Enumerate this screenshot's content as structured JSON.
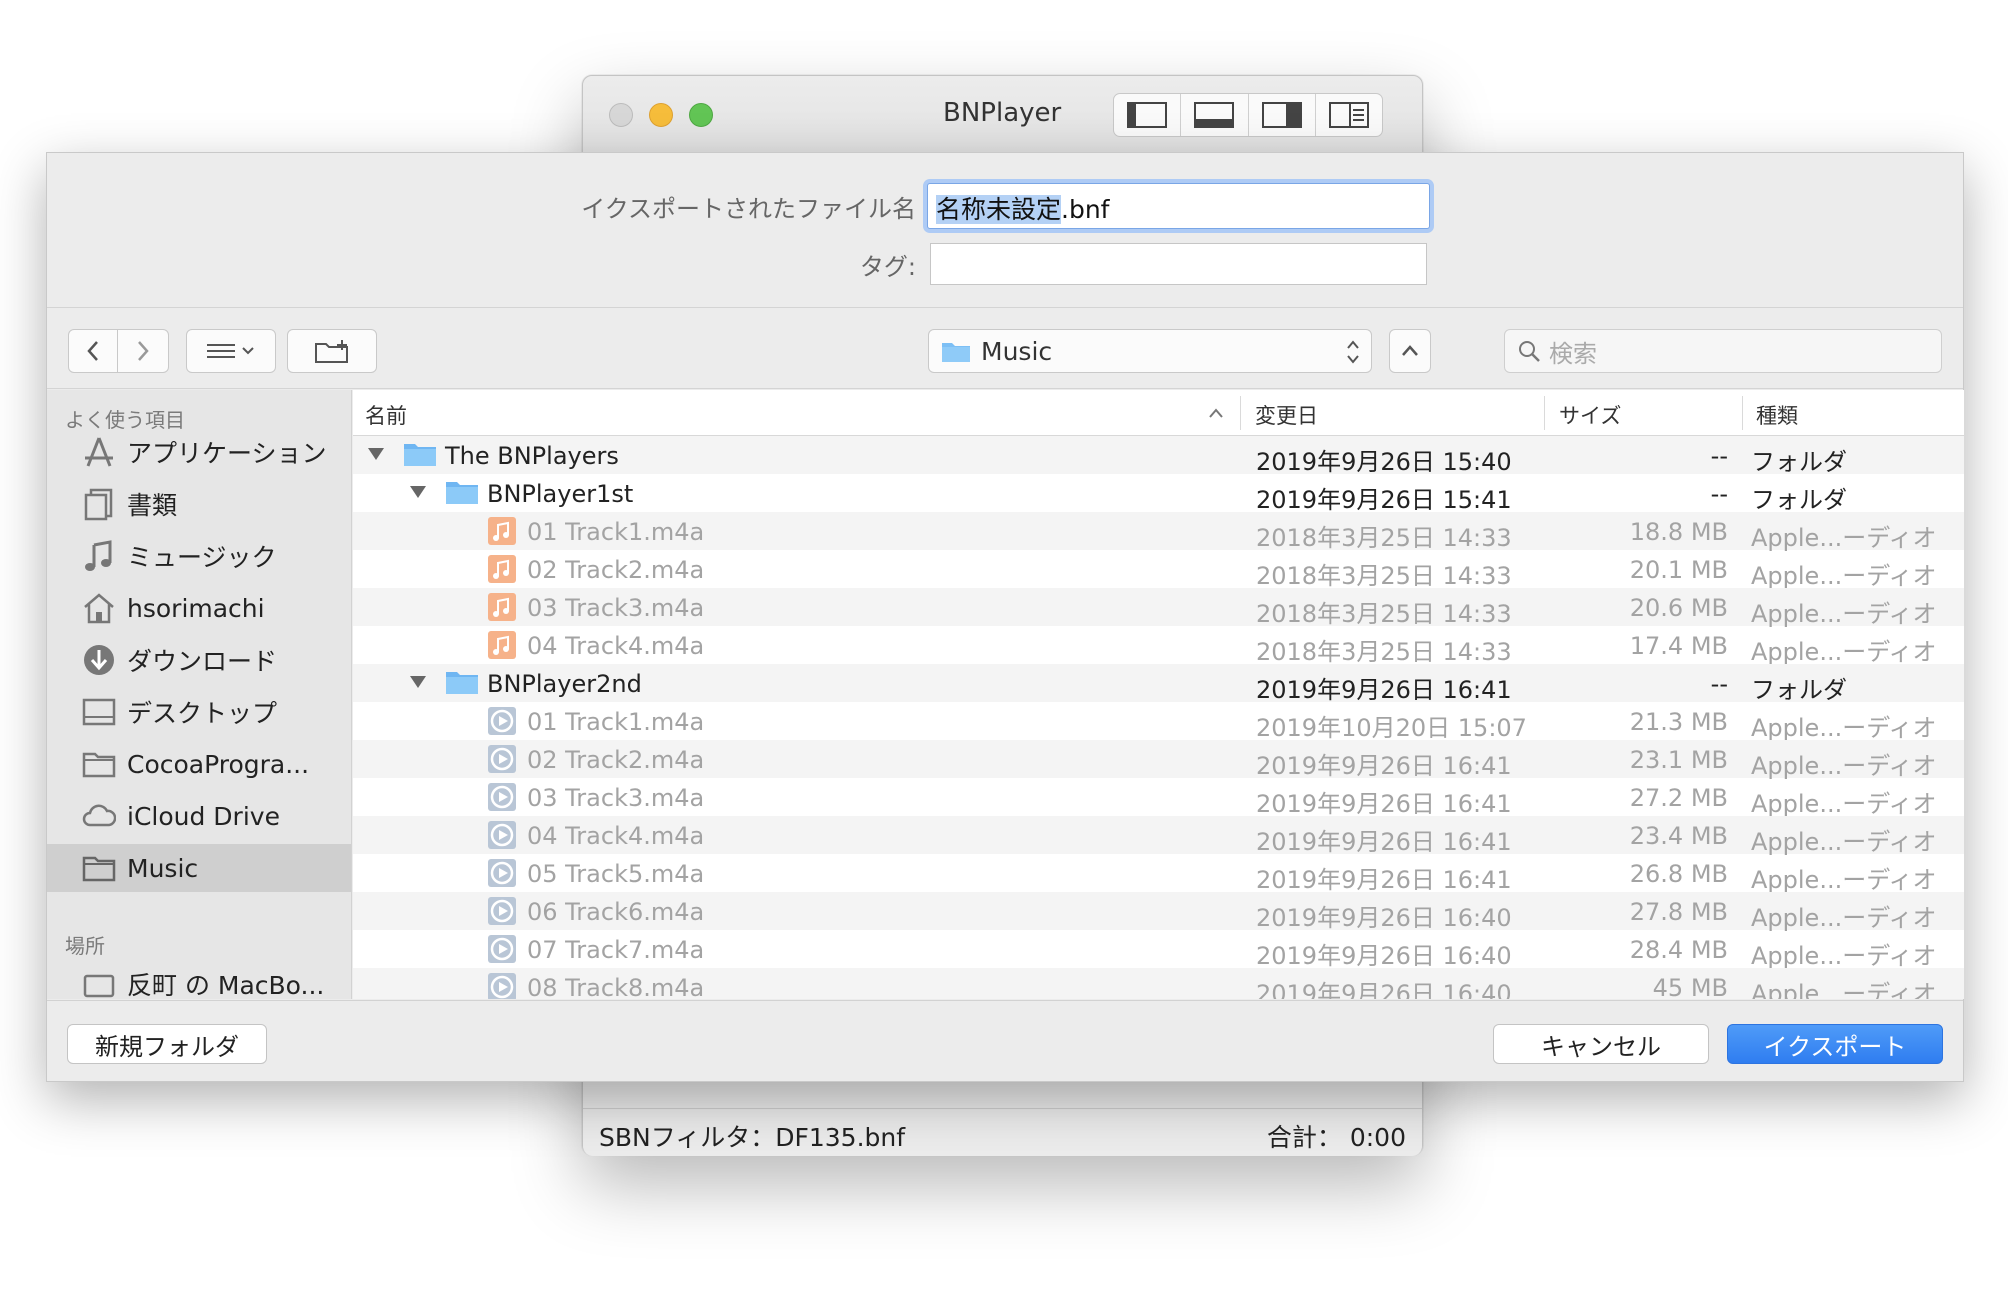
{
  "window": {
    "title": "BNPlayer",
    "status_filter": "SBNフィルタ：DF135.bnf",
    "status_total": "合計： 0:00"
  },
  "sheet": {
    "filename_label": "イクスポートされたファイル名",
    "filename_selected": "名称未設定",
    "filename_ext": ".bnf",
    "tag_label": "タグ:",
    "location": "Music",
    "search_placeholder": "検索",
    "new_folder_label": "新規フォルダ",
    "cancel_label": "キャンセル",
    "export_label": "イクスポート"
  },
  "sidebar": {
    "favorites_title": "よく使う項目",
    "places_title": "場所",
    "items": [
      {
        "label": "アプリケーション",
        "icon": "applications-icon"
      },
      {
        "label": "書類",
        "icon": "documents-icon"
      },
      {
        "label": "ミュージック",
        "icon": "music-note-icon"
      },
      {
        "label": "hsorimachi",
        "icon": "home-icon"
      },
      {
        "label": "ダウンロード",
        "icon": "downloads-icon"
      },
      {
        "label": "デスクトップ",
        "icon": "desktop-icon"
      },
      {
        "label": "CocoaProgra...",
        "icon": "folder-icon"
      },
      {
        "label": "iCloud Drive",
        "icon": "cloud-icon"
      },
      {
        "label": "Music",
        "icon": "folder-icon",
        "selected": true
      }
    ],
    "place_items": [
      {
        "label": "反町 の MacBo...",
        "icon": "disk-icon"
      }
    ]
  },
  "columns": {
    "name": "名前",
    "date": "変更日",
    "size": "サイズ",
    "kind": "種類"
  },
  "rows": [
    {
      "name": "The BNPlayers",
      "date": "2019年9月26日 15:40",
      "size": "--",
      "kind": "フォルダ"
    },
    {
      "name": "BNPlayer1st",
      "date": "2019年9月26日 15:41",
      "size": "--",
      "kind": "フォルダ"
    },
    {
      "name": "01 Track1.m4a",
      "date": "2018年3月25日 14:33",
      "size": "18.8 MB",
      "kind": "Apple...ーディオ"
    },
    {
      "name": "02 Track2.m4a",
      "date": "2018年3月25日 14:33",
      "size": "20.1 MB",
      "kind": "Apple...ーディオ"
    },
    {
      "name": "03 Track3.m4a",
      "date": "2018年3月25日 14:33",
      "size": "20.6 MB",
      "kind": "Apple...ーディオ"
    },
    {
      "name": "04 Track4.m4a",
      "date": "2018年3月25日 14:33",
      "size": "17.4 MB",
      "kind": "Apple...ーディオ"
    },
    {
      "name": "BNPlayer2nd",
      "date": "2019年9月26日 16:41",
      "size": "--",
      "kind": "フォルダ"
    },
    {
      "name": "01 Track1.m4a",
      "date": "2019年10月20日 15:07",
      "size": "21.3 MB",
      "kind": "Apple...ーディオ"
    },
    {
      "name": "02 Track2.m4a",
      "date": "2019年9月26日 16:41",
      "size": "23.1 MB",
      "kind": "Apple...ーディオ"
    },
    {
      "name": "03 Track3.m4a",
      "date": "2019年9月26日 16:41",
      "size": "27.2 MB",
      "kind": "Apple...ーディオ"
    },
    {
      "name": "04 Track4.m4a",
      "date": "2019年9月26日 16:41",
      "size": "23.4 MB",
      "kind": "Apple...ーディオ"
    },
    {
      "name": "05 Track5.m4a",
      "date": "2019年9月26日 16:41",
      "size": "26.8 MB",
      "kind": "Apple...ーディオ"
    },
    {
      "name": "06 Track6.m4a",
      "date": "2019年9月26日 16:40",
      "size": "27.8 MB",
      "kind": "Apple...ーディオ"
    },
    {
      "name": "07 Track7.m4a",
      "date": "2019年9月26日 16:40",
      "size": "28.4 MB",
      "kind": "Apple...ーディオ"
    },
    {
      "name": "08 Track8.m4a",
      "date": "2019年9月26日 16:40",
      "size": "45 MB",
      "kind": "Apple...ーディオ"
    }
  ],
  "colors": {
    "accent": "#2f7df0",
    "folder": "#7cbff5",
    "dim_text": "#a3a3a3"
  }
}
